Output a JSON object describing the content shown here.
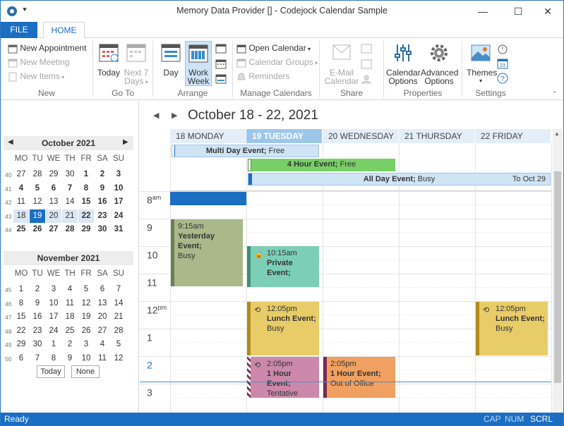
{
  "window": {
    "title": "Memory Data Provider [] - Codejock Calendar Sample",
    "minimize": "—",
    "maximize": "☐",
    "close": "✕"
  },
  "tabs": {
    "file": "FILE",
    "home": "HOME"
  },
  "ribbon": {
    "new_appointment": "New Appointment",
    "new_meeting": "New Meeting",
    "new_items": "New Items",
    "new_group": "New",
    "today": "Today",
    "next7_l1": "Next 7",
    "next7_l2": "Days",
    "goto_group": "Go To",
    "day": "Day",
    "work_l1": "Work",
    "work_l2": "Week",
    "arrange_group": "Arrange",
    "open_calendar": "Open Calendar",
    "calendar_groups": "Calendar Groups",
    "reminders": "Reminders",
    "manage_group": "Manage Calendars",
    "email_l1": "E-Mail",
    "email_l2": "Calendar",
    "share_group": "Share",
    "cal_opts_l1": "Calendar",
    "cal_opts_l2": "Options",
    "adv_opts_l1": "Advanced",
    "adv_opts_l2": "Options",
    "properties_group": "Properties",
    "themes": "Themes",
    "settings_group": "Settings"
  },
  "nav": {
    "oct": {
      "title": "October 2021",
      "dow": [
        "MO",
        "TU",
        "WE",
        "TH",
        "FR",
        "SA",
        "SU"
      ],
      "weeks": [
        {
          "wk": "40",
          "days": [
            "27",
            "28",
            "29",
            "30",
            "1",
            "2",
            "3"
          ]
        },
        {
          "wk": "41",
          "days": [
            "4",
            "5",
            "6",
            "7",
            "8",
            "9",
            "10"
          ]
        },
        {
          "wk": "42",
          "days": [
            "11",
            "12",
            "13",
            "14",
            "15",
            "16",
            "17"
          ]
        },
        {
          "wk": "43",
          "days": [
            "18",
            "19",
            "20",
            "21",
            "22",
            "23",
            "24"
          ]
        },
        {
          "wk": "44",
          "days": [
            "25",
            "26",
            "27",
            "28",
            "29",
            "30",
            "31"
          ]
        }
      ]
    },
    "nov": {
      "title": "November 2021",
      "dow": [
        "MO",
        "TU",
        "WE",
        "TH",
        "FR",
        "SA",
        "SU"
      ],
      "weeks": [
        {
          "wk": "45",
          "days": [
            "1",
            "2",
            "3",
            "4",
            "5",
            "6",
            "7"
          ]
        },
        {
          "wk": "46",
          "days": [
            "8",
            "9",
            "10",
            "11",
            "12",
            "13",
            "14"
          ]
        },
        {
          "wk": "47",
          "days": [
            "15",
            "16",
            "17",
            "18",
            "19",
            "20",
            "21"
          ]
        },
        {
          "wk": "48",
          "days": [
            "22",
            "23",
            "24",
            "25",
            "26",
            "27",
            "28"
          ]
        },
        {
          "wk": "49",
          "days": [
            "29",
            "30",
            "1",
            "2",
            "3",
            "4",
            "5"
          ]
        },
        {
          "wk": "50",
          "days": [
            "6",
            "7",
            "8",
            "9",
            "10",
            "11",
            "12"
          ]
        }
      ]
    },
    "today_btn": "Today",
    "none_btn": "None"
  },
  "calendar": {
    "range_title": "October 18 - 22, 2021",
    "day_headers": [
      "18 MONDAY",
      "19 TUESDAY",
      "20 WEDNESDAY",
      "21 THURSDAY",
      "22 FRIDAY"
    ],
    "hours": [
      {
        "h": "8",
        "suffix": "am"
      },
      {
        "h": "9",
        "suffix": ""
      },
      {
        "h": "10",
        "suffix": ""
      },
      {
        "h": "11",
        "suffix": ""
      },
      {
        "h": "12",
        "suffix": "pm"
      },
      {
        "h": "1",
        "suffix": ""
      },
      {
        "h": "2",
        "suffix": ""
      },
      {
        "h": "3",
        "suffix": ""
      }
    ],
    "all_day": [
      {
        "title": "Multi Day Event;",
        "status": "Free"
      },
      {
        "title": "4 Hour Event;",
        "status": "Free"
      },
      {
        "title": "All Day Event;",
        "status": "Busy",
        "to": "To Oct 29"
      }
    ],
    "events": [
      {
        "time": "9:15am",
        "title": "Yesterday Event;",
        "status": "Busy"
      },
      {
        "time": "10:15am",
        "title": "Private",
        "title2": "Event;",
        "status": ""
      },
      {
        "time": "12:05pm",
        "title": "Lunch Event;",
        "status": "Busy"
      },
      {
        "time": "12:05pm",
        "title": "Lunch Event;",
        "status": "Busy"
      },
      {
        "time": "2:05pm",
        "title": "1 Hour Event;",
        "status": "Tentative"
      },
      {
        "time": "2:05pm",
        "title": "1 Hour Event;",
        "status": "Out of Office"
      }
    ]
  },
  "status": {
    "ready": "Ready",
    "cap": "CAP",
    "num": "NUM",
    "scrl": "SCRL"
  },
  "colors": {
    "accent": "#1b6ec2",
    "yesterday": "#a9b98a",
    "private": "#7ccfb5",
    "lunch": "#e8cc68",
    "tentative": "#cc88aa",
    "ooo": "#f0a060",
    "four_hour": "#79cf67"
  }
}
